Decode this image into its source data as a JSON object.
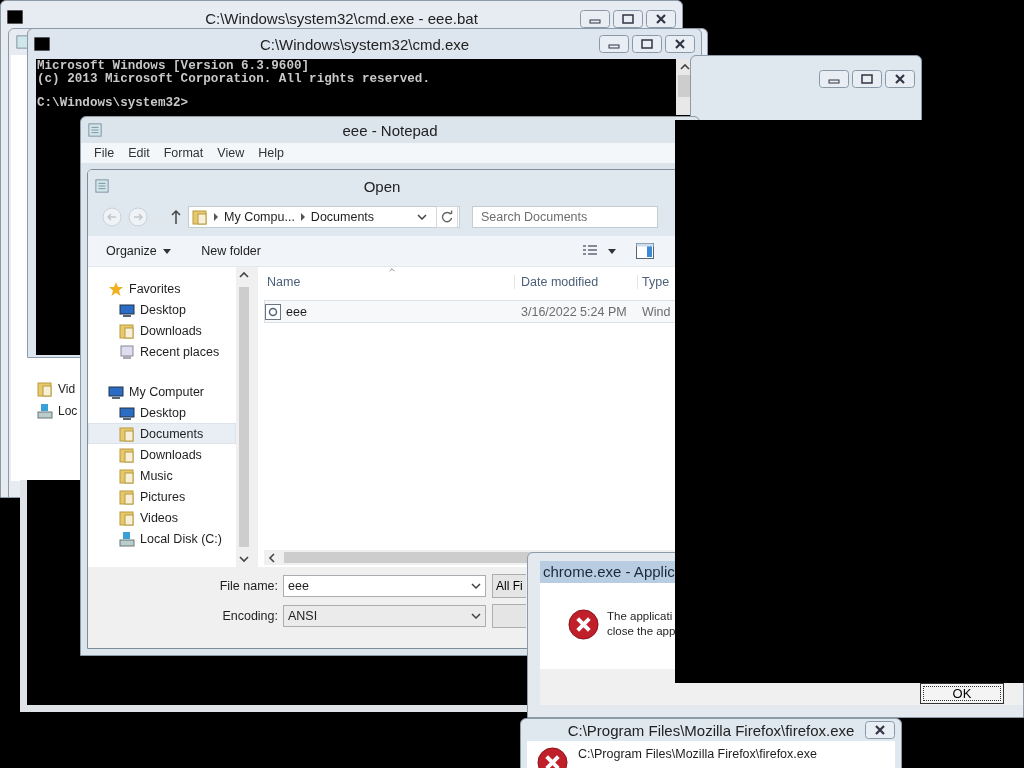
{
  "batch_window": {
    "title": "C:\\Windows\\system32\\cmd.exe - eee.bat"
  },
  "explorer_window": {
    "items": [
      {
        "label": "Vid",
        "kind": "videos"
      },
      {
        "label": "Loc",
        "kind": "disk"
      }
    ]
  },
  "console_window": {
    "title": "C:\\Windows\\system32\\cmd.exe",
    "lines": [
      "Microsoft Windows [Version 6.3.9600]",
      "(c) 2013 Microsoft Corporation. All rights reserved."
    ],
    "prompt": "C:\\Windows\\system32>"
  },
  "notepad": {
    "title": "eee - Notepad",
    "menu": [
      "File",
      "Edit",
      "Format",
      "View",
      "Help"
    ]
  },
  "open_dialog": {
    "title": "Open",
    "breadcrumb": [
      "My Compu...",
      "Documents"
    ],
    "search": {
      "placeholder": "Search Documents"
    },
    "toolbar": [
      "Organize",
      "New folder"
    ],
    "tree": [
      {
        "label": "Favorites",
        "kind": "star",
        "selected": false,
        "children": [
          {
            "label": "Desktop",
            "kind": "desktop",
            "selected": false
          },
          {
            "label": "Downloads",
            "kind": "downloads",
            "selected": false
          },
          {
            "label": "Recent places",
            "kind": "recent",
            "selected": false
          }
        ]
      },
      {
        "label": "My Computer",
        "kind": "computer",
        "selected": false,
        "children": [
          {
            "label": "Desktop",
            "kind": "desktop",
            "selected": false
          },
          {
            "label": "Documents",
            "kind": "documents",
            "selected": true
          },
          {
            "label": "Downloads",
            "kind": "downloads",
            "selected": false
          },
          {
            "label": "Music",
            "kind": "music",
            "selected": false
          },
          {
            "label": "Pictures",
            "kind": "pictures",
            "selected": false
          },
          {
            "label": "Videos",
            "kind": "videos",
            "selected": false
          },
          {
            "label": "Local Disk (C:)",
            "kind": "disk",
            "selected": false
          }
        ]
      }
    ],
    "columns": [
      "Name",
      "Date modified",
      "Type"
    ],
    "rows": [
      {
        "name": "eee",
        "date": "3/16/2022 5:24 PM",
        "type": "Wind"
      }
    ],
    "file_name": {
      "label": "File name:",
      "value": "eee"
    },
    "file_type": "All Fi",
    "encoding": {
      "label": "Encoding:",
      "value": "ANSI"
    }
  },
  "error_dialog": {
    "title": "chrome.exe - Applic",
    "lines": [
      "The applicati",
      "close the app"
    ],
    "button": "OK"
  },
  "firefox_dialog": {
    "title": "C:\\Program Files\\Mozilla Firefox\\firefox.exe",
    "message": "C:\\Program Files\\Mozilla Firefox\\firefox.exe"
  }
}
